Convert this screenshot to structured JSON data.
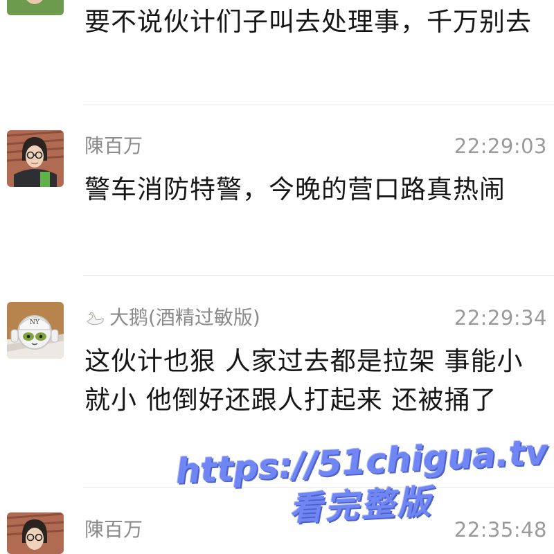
{
  "messages": [
    {
      "sender": "",
      "time": "",
      "text": "要不说伙计们子叫去处理事，千万别去"
    },
    {
      "sender": "陳百万",
      "time": "22:29:03",
      "text": "警车消防特警，今晚的营口路真热闹",
      "avatar_icon": "person-avatar-icon"
    },
    {
      "sender": "大鹅(酒精过敏版)",
      "sender_icon": "swan-icon",
      "time": "22:29:34",
      "text": "这伙计也狠 人家过去都是拉架 事能小就小 他倒好还跟人打起来 还被捅了",
      "avatar_icon": "cat-avatar-icon"
    },
    {
      "sender": "陳百万",
      "time": "22:35:48",
      "text": "",
      "avatar_icon": "person-avatar-icon"
    }
  ],
  "watermark": {
    "line1": "https://51chigua.tv",
    "line2": "看完整版"
  },
  "colors": {
    "sender_text": "#8a8a8a",
    "timestamp_text": "#9a9a9a",
    "message_text": "#161616",
    "divider": "#e6e6e6",
    "watermark": "#6f86f4"
  }
}
